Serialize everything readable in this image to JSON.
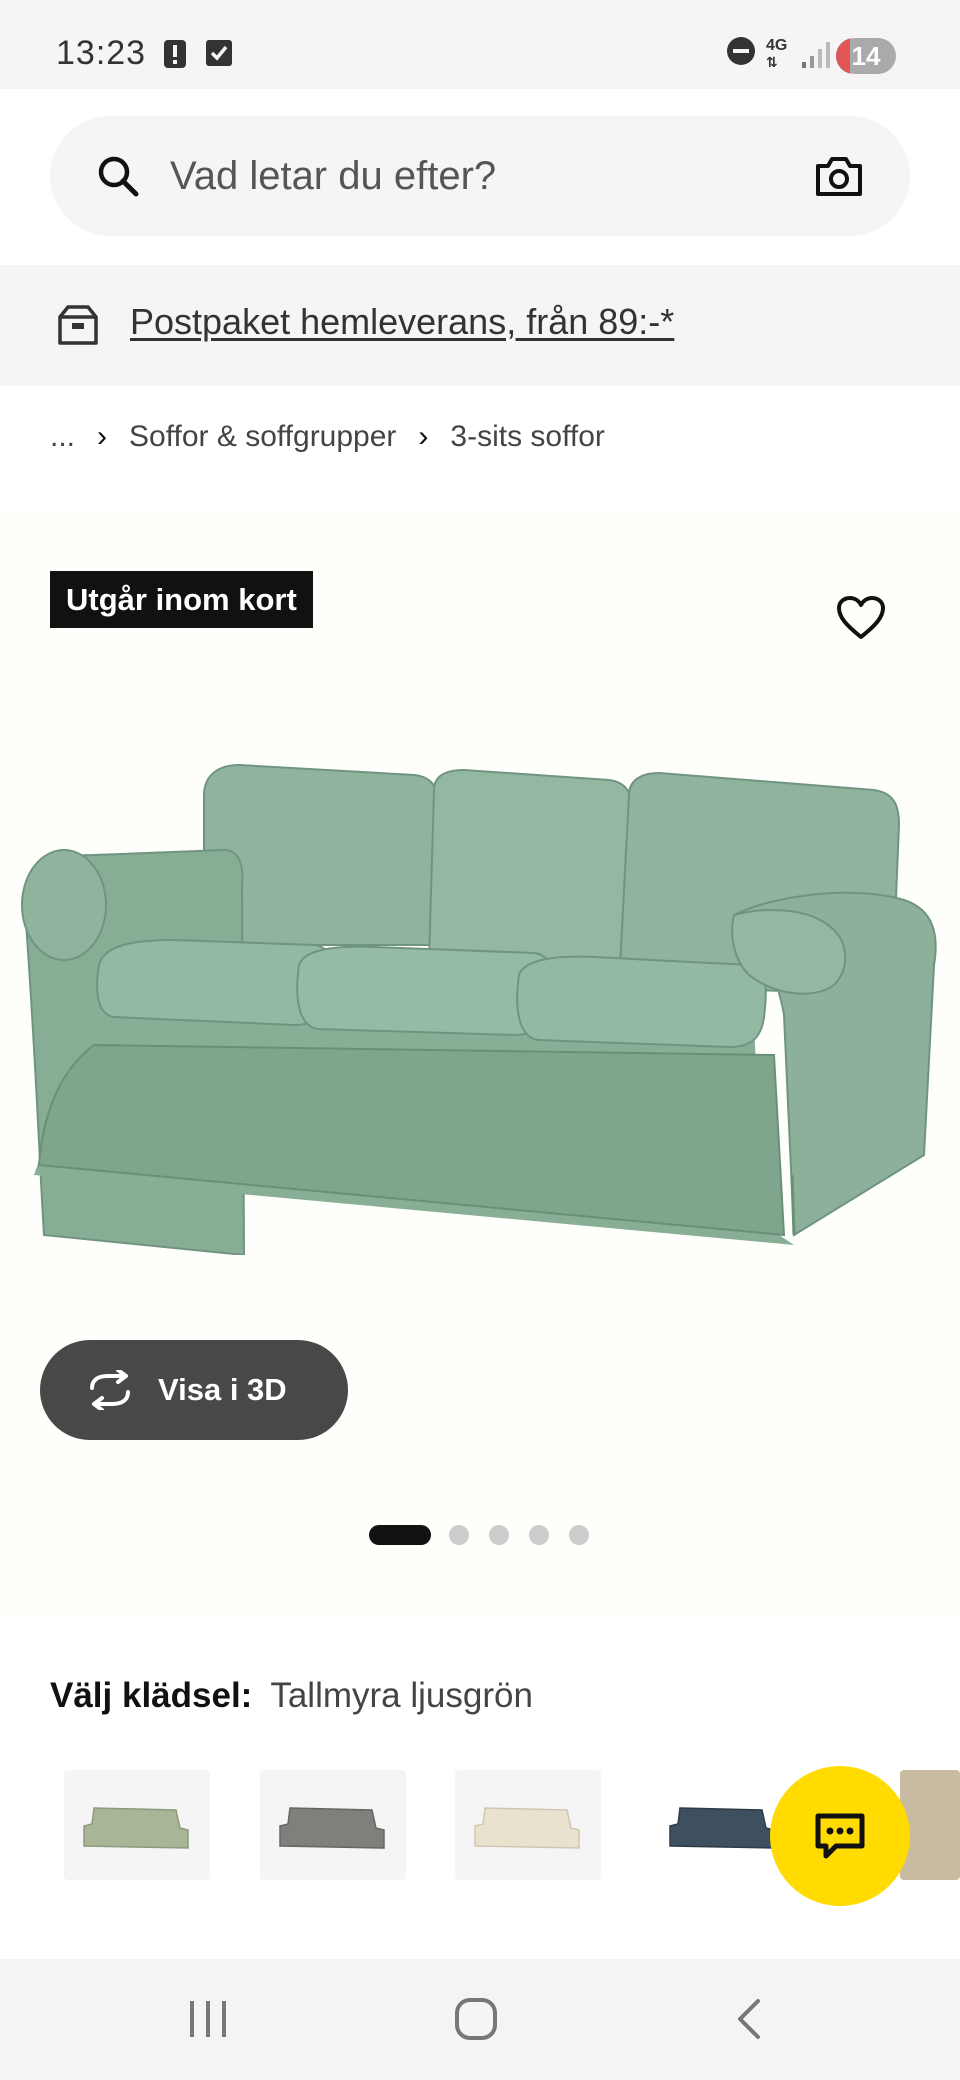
{
  "status_bar": {
    "time": "13:23",
    "network": "4G",
    "battery": "14"
  },
  "search": {
    "placeholder": "Vad letar du efter?",
    "icon": "search-icon",
    "camera_icon": "camera-icon"
  },
  "banner": {
    "text": "Postpaket hemleverans, från 89:-*",
    "icon": "package-icon"
  },
  "breadcrumb": {
    "items": [
      "...",
      "Soffor & soffgrupper",
      "3-sits soffor"
    ]
  },
  "product": {
    "badge": "Utgår inom kort",
    "view_3d_label": "Visa i 3D",
    "carousel": {
      "count": 5,
      "active_index": 0
    }
  },
  "upholstery": {
    "label": "Välj klädsel:",
    "value": "Tallmyra ljusgrön",
    "swatches": [
      {
        "color": "#a8b596"
      },
      {
        "color": "#7f7f7b"
      },
      {
        "color": "#e9e2cf"
      },
      {
        "color": "#3e4f60"
      },
      {
        "color": "#b9ab93"
      }
    ]
  },
  "colors": {
    "accent_yellow": "#ffdb00",
    "sofa_green": "#8fb39c",
    "badge_bg": "#111111"
  }
}
